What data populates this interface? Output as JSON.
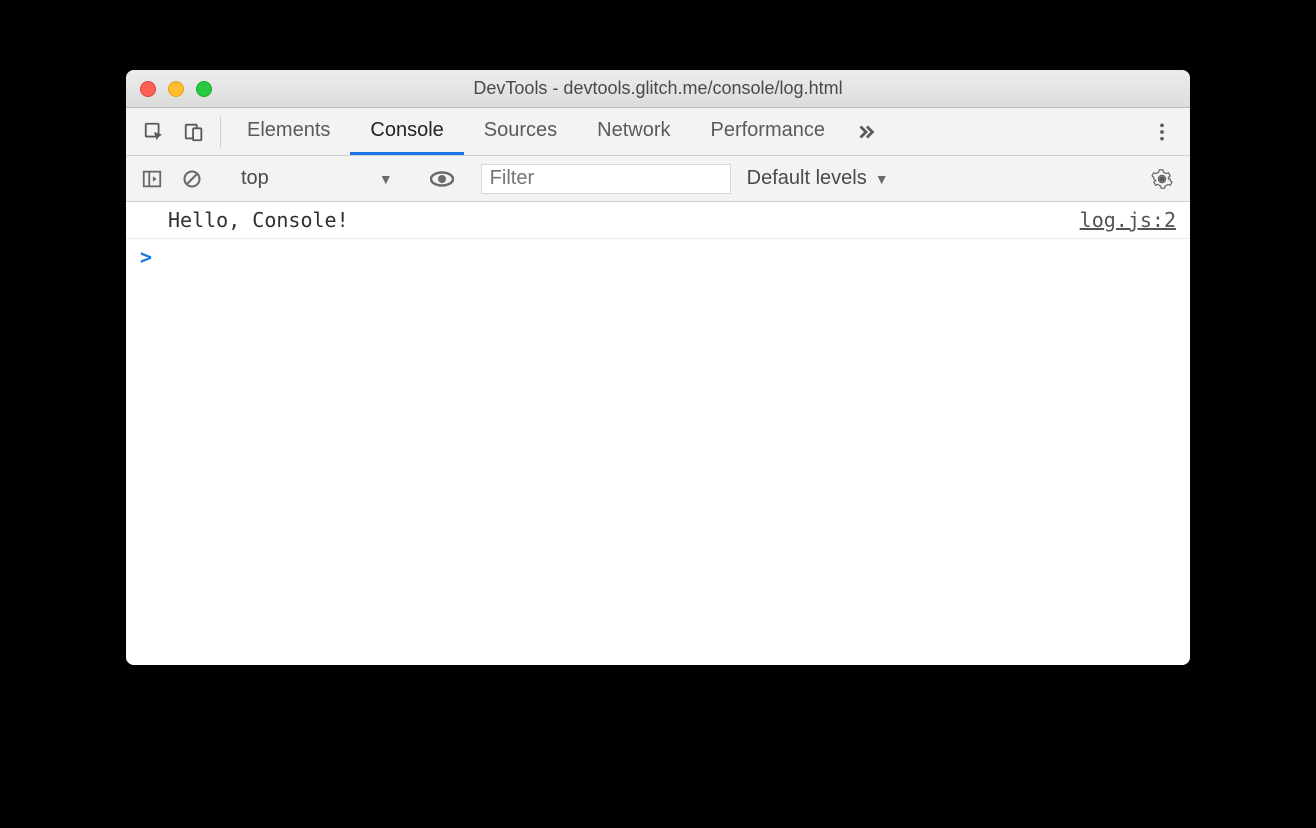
{
  "window": {
    "title": "DevTools - devtools.glitch.me/console/log.html"
  },
  "tabs": {
    "elements": "Elements",
    "console": "Console",
    "sources": "Sources",
    "network": "Network",
    "performance": "Performance"
  },
  "toolbar": {
    "context": "top",
    "filter_placeholder": "Filter",
    "levels": "Default levels"
  },
  "console": {
    "rows": [
      {
        "message": "Hello, Console!",
        "source": "log.js:2"
      }
    ],
    "prompt": ">"
  }
}
